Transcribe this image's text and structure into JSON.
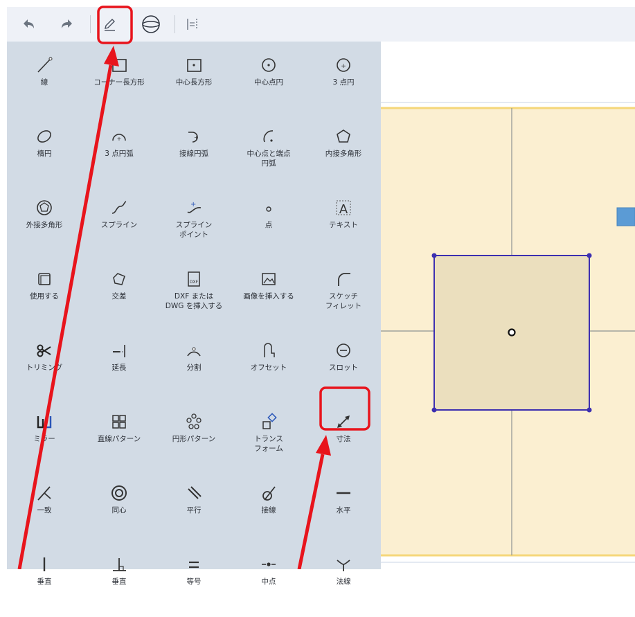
{
  "toolbar": {
    "icons": [
      "undo-icon",
      "redo-icon",
      "sketch-pencil-icon",
      "sphere-icon",
      "constraint-icon"
    ]
  },
  "palette": {
    "rows": [
      [
        {
          "label": "線",
          "icon": "line-icon"
        },
        {
          "label": "コーナー長方形",
          "icon": "corner-rectangle-icon"
        },
        {
          "label": "中心長方形",
          "icon": "center-rectangle-icon"
        },
        {
          "label": "中心点円",
          "icon": "center-circle-icon"
        },
        {
          "label": "3 点円",
          "icon": "three-point-circle-icon"
        }
      ],
      [
        {
          "label": "楕円",
          "icon": "ellipse-icon"
        },
        {
          "label": "3 点円弧",
          "icon": "three-point-arc-icon"
        },
        {
          "label": "接線円弧",
          "icon": "tangent-arc-icon"
        },
        {
          "label": "中心点と端点\n円弧",
          "icon": "center-end-arc-icon"
        },
        {
          "label": "内接多角形",
          "icon": "inscribed-polygon-icon"
        }
      ],
      [
        {
          "label": "外接多角形",
          "icon": "circumscribed-polygon-icon"
        },
        {
          "label": "スプライン",
          "icon": "spline-icon"
        },
        {
          "label": "スプライン\nポイント",
          "icon": "spline-point-icon"
        },
        {
          "label": "点",
          "icon": "point-icon"
        },
        {
          "label": "テキスト",
          "icon": "text-icon"
        }
      ],
      [
        {
          "label": "使用する",
          "icon": "use-icon"
        },
        {
          "label": "交差",
          "icon": "intersect-icon"
        },
        {
          "label": "DXF または\nDWG を挿入する",
          "icon": "insert-dxf-icon"
        },
        {
          "label": "画像を挿入する",
          "icon": "insert-image-icon"
        },
        {
          "label": "スケッチ\nフィレット",
          "icon": "sketch-fillet-icon"
        }
      ],
      [
        {
          "label": "トリミング",
          "icon": "trim-icon"
        },
        {
          "label": "延長",
          "icon": "extend-icon"
        },
        {
          "label": "分割",
          "icon": "split-icon"
        },
        {
          "label": "オフセット",
          "icon": "offset-icon"
        },
        {
          "label": "スロット",
          "icon": "slot-icon"
        }
      ],
      [
        {
          "label": "ミラー",
          "icon": "mirror-icon"
        },
        {
          "label": "直線パターン",
          "icon": "linear-pattern-icon"
        },
        {
          "label": "円形パターン",
          "icon": "circular-pattern-icon"
        },
        {
          "label": "トランス\nフォーム",
          "icon": "transform-icon"
        },
        {
          "label": "寸法",
          "icon": "dimension-icon"
        }
      ],
      [
        {
          "label": "一致",
          "icon": "coincident-icon"
        },
        {
          "label": "同心",
          "icon": "concentric-icon"
        },
        {
          "label": "平行",
          "icon": "parallel-icon"
        },
        {
          "label": "接線",
          "icon": "tangent-icon"
        },
        {
          "label": "水平",
          "icon": "horizontal-icon"
        }
      ],
      [
        {
          "label": "垂直",
          "icon": "vertical-icon"
        },
        {
          "label": "垂直",
          "icon": "perpendicular-icon"
        },
        {
          "label": "等号",
          "icon": "equal-icon"
        },
        {
          "label": "中点",
          "icon": "midpoint-icon"
        },
        {
          "label": "法線",
          "icon": "normal-icon"
        }
      ]
    ]
  },
  "colors": {
    "panel_bg": "#d2dbe5",
    "toolbar_bg": "#eef1f7",
    "sketch_plane": "#fbefd1",
    "plane_border": "#f5d77a",
    "square_stroke": "#3c2fb0",
    "square_fill": "#ebdfbe",
    "annotation_red": "#e8141c",
    "view_cube_blue": "#5b9bd5"
  }
}
